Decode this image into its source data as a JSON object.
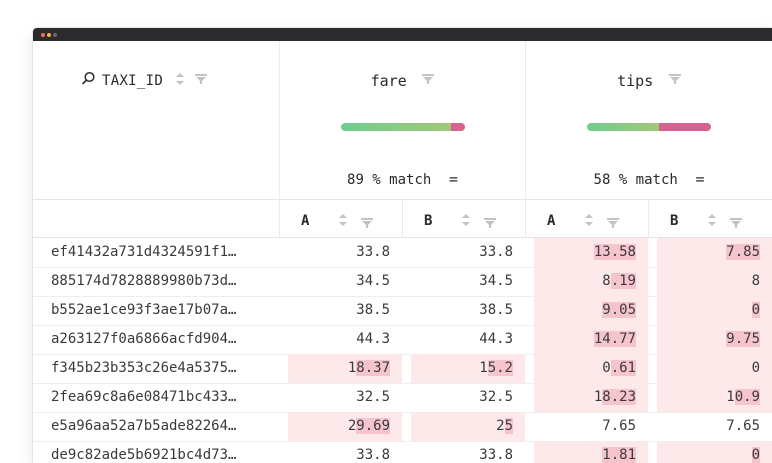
{
  "window": {
    "title_dots": [
      "close",
      "minimize",
      "zoom"
    ]
  },
  "header": {
    "id_column": {
      "label": "TAXI_ID",
      "search_icon": "search-icon",
      "sort_icon": "sort-icon",
      "filter_icon": "filter-icon"
    },
    "columns": [
      {
        "name": "fare",
        "match_label": "89 % match",
        "match_fraction": 0.89,
        "match_icon": "equals-icon",
        "sub": [
          {
            "label": "A"
          },
          {
            "label": "B"
          }
        ]
      },
      {
        "name": "tips",
        "match_label": "58 % match",
        "match_fraction": 0.58,
        "match_icon": "equals-icon",
        "sub": [
          {
            "label": "A"
          },
          {
            "label": "B"
          }
        ]
      }
    ]
  },
  "colors": {
    "match_green": "#8bc98a",
    "mismatch_pink": "#d4648f",
    "diff_bg": "#fde8ea",
    "diff_char": "#f6c4cc"
  },
  "rows": [
    {
      "id": "ef41432a731d4324591f1…",
      "fareA": "33.8",
      "fareB": "33.8",
      "tipsA": "13.58",
      "tipsB": "7.85",
      "fare_diff": false,
      "tips_diff": true
    },
    {
      "id": "885174d7828889980b73d…",
      "fareA": "34.5",
      "fareB": "34.5",
      "tipsA": "8.19",
      "tipsB": "8",
      "fare_diff": false,
      "tips_diff": true
    },
    {
      "id": "b552ae1ce93f3ae17b07a…",
      "fareA": "38.5",
      "fareB": "38.5",
      "tipsA": "9.05",
      "tipsB": "0",
      "fare_diff": false,
      "tips_diff": true
    },
    {
      "id": "a263127f0a6866acfd904…",
      "fareA": "44.3",
      "fareB": "44.3",
      "tipsA": "14.77",
      "tipsB": "9.75",
      "fare_diff": false,
      "tips_diff": true
    },
    {
      "id": "f345b23b353c26e4a5375…",
      "fareA": "18.37",
      "fareB": "15.2",
      "tipsA": "0.61",
      "tipsB": "0",
      "fare_diff": true,
      "tips_diff": true
    },
    {
      "id": "2fea69c8a6e08471bc433…",
      "fareA": "32.5",
      "fareB": "32.5",
      "tipsA": "18.23",
      "tipsB": "10.9",
      "fare_diff": false,
      "tips_diff": true
    },
    {
      "id": "e5a96aa52a7b5ade82264…",
      "fareA": "29.69",
      "fareB": "25",
      "tipsA": "7.65",
      "tipsB": "7.65",
      "fare_diff": true,
      "tips_diff": false
    },
    {
      "id": "de9c82ade5b6921bc4d73…",
      "fareA": "33.8",
      "fareB": "33.8",
      "tipsA": "1.81",
      "tipsB": "0",
      "fare_diff": false,
      "tips_diff": true
    }
  ]
}
